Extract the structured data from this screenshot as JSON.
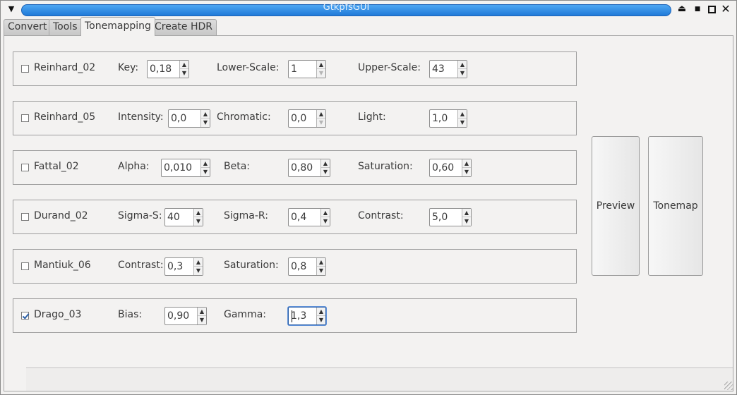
{
  "window": {
    "title": "GtkpfsGUI",
    "menu_icon": "chevron-down-icon",
    "controls": [
      "eject-icon",
      "minimize-icon",
      "maximize-icon",
      "close-icon"
    ]
  },
  "tabs": [
    {
      "label": "Convert",
      "active": false
    },
    {
      "label": "Tools",
      "active": false
    },
    {
      "label": "Tonemapping",
      "active": true
    },
    {
      "label": "Create HDR",
      "active": false
    }
  ],
  "operators": [
    {
      "name": "Reinhard_02",
      "checked": false,
      "params": [
        {
          "label": "Key:",
          "value": "0,18"
        },
        {
          "label": "Lower-Scale:",
          "value": "1"
        },
        {
          "label": "Upper-Scale:",
          "value": "43"
        }
      ]
    },
    {
      "name": "Reinhard_05",
      "checked": false,
      "params": [
        {
          "label": "Intensity:",
          "value": "0,0"
        },
        {
          "label": "Chromatic:",
          "value": "0,0"
        },
        {
          "label": "Light:",
          "value": "1,0"
        }
      ]
    },
    {
      "name": "Fattal_02",
      "checked": false,
      "params": [
        {
          "label": "Alpha:",
          "value": "0,010"
        },
        {
          "label": "Beta:",
          "value": "0,80"
        },
        {
          "label": "Saturation:",
          "value": "0,60"
        }
      ]
    },
    {
      "name": "Durand_02",
      "checked": false,
      "params": [
        {
          "label": "Sigma-S:",
          "value": "40"
        },
        {
          "label": "Sigma-R:",
          "value": "0,4"
        },
        {
          "label": "Contrast:",
          "value": "5,0"
        }
      ]
    },
    {
      "name": "Mantiuk_06",
      "checked": false,
      "params": [
        {
          "label": "Contrast:",
          "value": "0,3"
        },
        {
          "label": "Saturation:",
          "value": "0,8"
        }
      ]
    },
    {
      "name": "Drago_03",
      "checked": true,
      "params": [
        {
          "label": "Bias:",
          "value": "0,90"
        },
        {
          "label": "Gamma:",
          "value": "1,3"
        }
      ]
    }
  ],
  "actions": {
    "preview_label": "Preview",
    "tonemap_label": "Tonemap"
  },
  "colors": {
    "titlebar_accent": "#1f7ad8",
    "background": "#f3f2f1",
    "focus": "#2a5fa8"
  }
}
